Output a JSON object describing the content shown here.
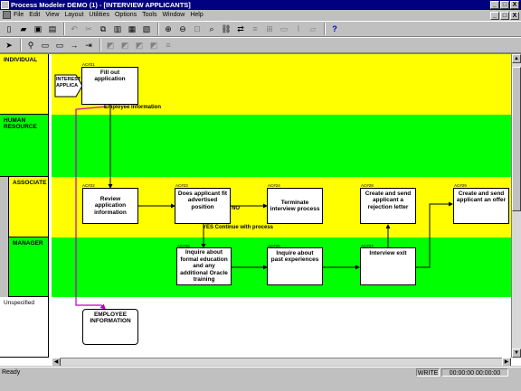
{
  "window": {
    "title": "Process Modeler DEMO (1) - [INTERVIEW APPLICANTS]",
    "controls": [
      "_",
      "□",
      "X"
    ]
  },
  "menu": [
    "File",
    "Edit",
    "View",
    "Layout",
    "Utilities",
    "Options",
    "Tools",
    "Window",
    "Help"
  ],
  "toolbar1_icons": [
    "new-icon",
    "open-icon",
    "save-icon",
    "print-icon",
    "undo-icon",
    "cut-icon",
    "copy-icon",
    "paste-icon",
    "delete-icon",
    "properties-icon",
    "zoom-in-icon",
    "zoom-out-icon",
    "zoom-fit-icon",
    "find-icon",
    "link-icon",
    "navigate-icon",
    "align-icon",
    "grid-icon",
    "comment-icon",
    "attach-icon",
    "note-icon",
    "help-icon"
  ],
  "toolbar2_icons": [
    "pointer-icon",
    "actor-icon",
    "activity-icon",
    "rectangle-icon",
    "arrow-icon",
    "connector-icon",
    "shape1-icon",
    "shape2-icon",
    "shape3-icon",
    "shape4-icon",
    "shape5-icon"
  ],
  "lanes": [
    {
      "label": "INDIVIDUAL"
    },
    {
      "label": "HUMAN RESOURCE"
    },
    {
      "label": "ASSOCIATE"
    },
    {
      "label": "MANAGER"
    },
    {
      "label": "Unspecified"
    }
  ],
  "activities": {
    "fill_out": {
      "code": "AC#21",
      "label": "Fill out application"
    },
    "review": {
      "code": "AC#22",
      "label": "Review application information"
    },
    "fit": {
      "code": "AC#23",
      "label": "Does applicant fit advertised position"
    },
    "terminate": {
      "code": "AC#24",
      "label": "Terminate interview process"
    },
    "rejection": {
      "code": "AC#28",
      "label": "Create and send applicant a rejection letter"
    },
    "offer": {
      "code": "AC#29",
      "label": "Create and send applicant an offer"
    },
    "education": {
      "code": "AC#26",
      "label": "Inquire about formal education and any additional Oracle training"
    },
    "past_exp": {
      "code": "AC#25",
      "label": "Inquire about past experiences"
    },
    "exit": {
      "code": "AC#27",
      "label": "Interview exit"
    },
    "employee_info": {
      "label": "EMPLOYEE INFORMATION"
    }
  },
  "actor": {
    "label": "INTEREST APPLICA"
  },
  "connection_labels": {
    "employee_info": "Employee Information",
    "no": "NO",
    "yes": "YES Continue with process"
  },
  "status": {
    "text": "Ready",
    "mode": "WRITE",
    "time": "00:00:00 00:00:00"
  }
}
